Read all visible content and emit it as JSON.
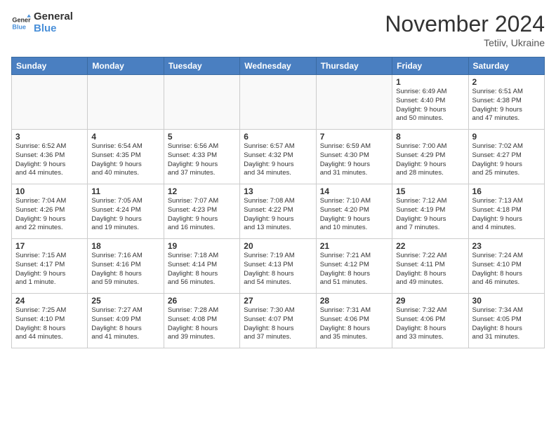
{
  "header": {
    "logo_line1": "General",
    "logo_line2": "Blue",
    "month_title": "November 2024",
    "location": "Tetiiv, Ukraine"
  },
  "weekdays": [
    "Sunday",
    "Monday",
    "Tuesday",
    "Wednesday",
    "Thursday",
    "Friday",
    "Saturday"
  ],
  "weeks": [
    [
      {
        "day": "",
        "info": ""
      },
      {
        "day": "",
        "info": ""
      },
      {
        "day": "",
        "info": ""
      },
      {
        "day": "",
        "info": ""
      },
      {
        "day": "",
        "info": ""
      },
      {
        "day": "1",
        "info": "Sunrise: 6:49 AM\nSunset: 4:40 PM\nDaylight: 9 hours\nand 50 minutes."
      },
      {
        "day": "2",
        "info": "Sunrise: 6:51 AM\nSunset: 4:38 PM\nDaylight: 9 hours\nand 47 minutes."
      }
    ],
    [
      {
        "day": "3",
        "info": "Sunrise: 6:52 AM\nSunset: 4:36 PM\nDaylight: 9 hours\nand 44 minutes."
      },
      {
        "day": "4",
        "info": "Sunrise: 6:54 AM\nSunset: 4:35 PM\nDaylight: 9 hours\nand 40 minutes."
      },
      {
        "day": "5",
        "info": "Sunrise: 6:56 AM\nSunset: 4:33 PM\nDaylight: 9 hours\nand 37 minutes."
      },
      {
        "day": "6",
        "info": "Sunrise: 6:57 AM\nSunset: 4:32 PM\nDaylight: 9 hours\nand 34 minutes."
      },
      {
        "day": "7",
        "info": "Sunrise: 6:59 AM\nSunset: 4:30 PM\nDaylight: 9 hours\nand 31 minutes."
      },
      {
        "day": "8",
        "info": "Sunrise: 7:00 AM\nSunset: 4:29 PM\nDaylight: 9 hours\nand 28 minutes."
      },
      {
        "day": "9",
        "info": "Sunrise: 7:02 AM\nSunset: 4:27 PM\nDaylight: 9 hours\nand 25 minutes."
      }
    ],
    [
      {
        "day": "10",
        "info": "Sunrise: 7:04 AM\nSunset: 4:26 PM\nDaylight: 9 hours\nand 22 minutes."
      },
      {
        "day": "11",
        "info": "Sunrise: 7:05 AM\nSunset: 4:24 PM\nDaylight: 9 hours\nand 19 minutes."
      },
      {
        "day": "12",
        "info": "Sunrise: 7:07 AM\nSunset: 4:23 PM\nDaylight: 9 hours\nand 16 minutes."
      },
      {
        "day": "13",
        "info": "Sunrise: 7:08 AM\nSunset: 4:22 PM\nDaylight: 9 hours\nand 13 minutes."
      },
      {
        "day": "14",
        "info": "Sunrise: 7:10 AM\nSunset: 4:20 PM\nDaylight: 9 hours\nand 10 minutes."
      },
      {
        "day": "15",
        "info": "Sunrise: 7:12 AM\nSunset: 4:19 PM\nDaylight: 9 hours\nand 7 minutes."
      },
      {
        "day": "16",
        "info": "Sunrise: 7:13 AM\nSunset: 4:18 PM\nDaylight: 9 hours\nand 4 minutes."
      }
    ],
    [
      {
        "day": "17",
        "info": "Sunrise: 7:15 AM\nSunset: 4:17 PM\nDaylight: 9 hours\nand 1 minute."
      },
      {
        "day": "18",
        "info": "Sunrise: 7:16 AM\nSunset: 4:16 PM\nDaylight: 8 hours\nand 59 minutes."
      },
      {
        "day": "19",
        "info": "Sunrise: 7:18 AM\nSunset: 4:14 PM\nDaylight: 8 hours\nand 56 minutes."
      },
      {
        "day": "20",
        "info": "Sunrise: 7:19 AM\nSunset: 4:13 PM\nDaylight: 8 hours\nand 54 minutes."
      },
      {
        "day": "21",
        "info": "Sunrise: 7:21 AM\nSunset: 4:12 PM\nDaylight: 8 hours\nand 51 minutes."
      },
      {
        "day": "22",
        "info": "Sunrise: 7:22 AM\nSunset: 4:11 PM\nDaylight: 8 hours\nand 49 minutes."
      },
      {
        "day": "23",
        "info": "Sunrise: 7:24 AM\nSunset: 4:10 PM\nDaylight: 8 hours\nand 46 minutes."
      }
    ],
    [
      {
        "day": "24",
        "info": "Sunrise: 7:25 AM\nSunset: 4:10 PM\nDaylight: 8 hours\nand 44 minutes."
      },
      {
        "day": "25",
        "info": "Sunrise: 7:27 AM\nSunset: 4:09 PM\nDaylight: 8 hours\nand 41 minutes."
      },
      {
        "day": "26",
        "info": "Sunrise: 7:28 AM\nSunset: 4:08 PM\nDaylight: 8 hours\nand 39 minutes."
      },
      {
        "day": "27",
        "info": "Sunrise: 7:30 AM\nSunset: 4:07 PM\nDaylight: 8 hours\nand 37 minutes."
      },
      {
        "day": "28",
        "info": "Sunrise: 7:31 AM\nSunset: 4:06 PM\nDaylight: 8 hours\nand 35 minutes."
      },
      {
        "day": "29",
        "info": "Sunrise: 7:32 AM\nSunset: 4:06 PM\nDaylight: 8 hours\nand 33 minutes."
      },
      {
        "day": "30",
        "info": "Sunrise: 7:34 AM\nSunset: 4:05 PM\nDaylight: 8 hours\nand 31 minutes."
      }
    ]
  ]
}
